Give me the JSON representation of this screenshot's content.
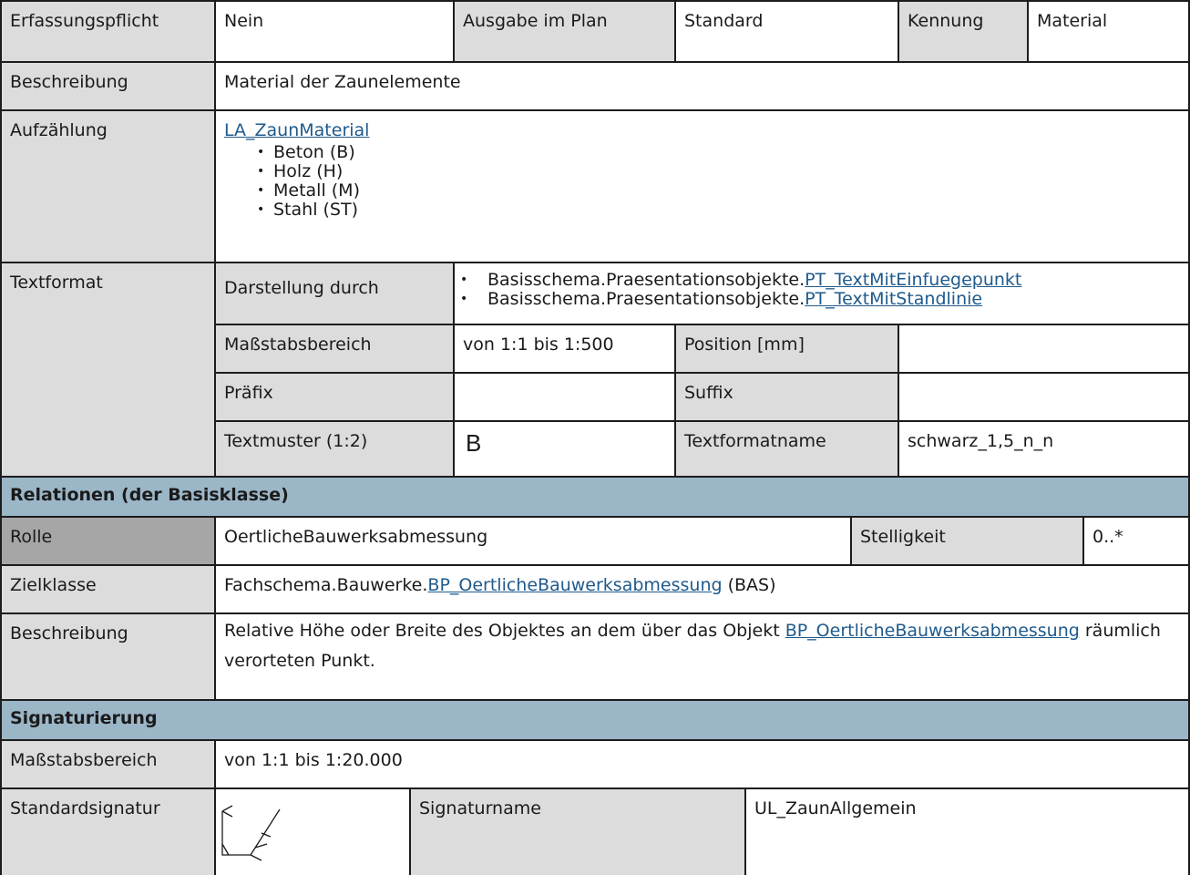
{
  "row_erfassung": {
    "label": "Erfassungspflicht",
    "value": "Nein",
    "ausgabe_label": "Ausgabe im Plan",
    "ausgabe_value": "Standard",
    "kennung_label": "Kennung",
    "kennung_value": "Material"
  },
  "beschreibung": {
    "label": "Beschreibung",
    "value": "Material der Zaunelemente"
  },
  "aufzaehlung": {
    "label": "Aufzählung",
    "link": "LA_ZaunMaterial",
    "items": [
      "Beton (B)",
      "Holz (H)",
      "Metall (M)",
      "Stahl (ST)"
    ]
  },
  "textformat": {
    "label": "Textformat",
    "darstellung_label": "Darstellung durch",
    "darstellung": [
      {
        "prefix": "Basisschema.Praesentationsobjekte.",
        "link": "PT_TextMitEinfuegepunkt"
      },
      {
        "prefix": "Basisschema.Praesentationsobjekte.",
        "link": "PT_TextMitStandlinie"
      }
    ],
    "massstab_label": "Maßstabsbereich",
    "massstab_value": "von 1:1 bis 1:500",
    "position_label": "Position [mm]",
    "position_value": "",
    "praefix_label": "Präfix",
    "praefix_value": "",
    "suffix_label": "Suffix",
    "suffix_value": "",
    "textmuster_label": "Textmuster (1:2)",
    "textmuster_value": "B",
    "textformatname_label": "Textformatname",
    "textformatname_value": "schwarz_1,5_n_n"
  },
  "relationen": {
    "header": "Relationen (der Basisklasse)",
    "rolle_label": "Rolle",
    "rolle_value": "OertlicheBauwerksabmessung",
    "stelligkeit_label": "Stelligkeit",
    "stelligkeit_value": "0..*",
    "zielklasse_label": "Zielklasse",
    "zielklasse_prefix": "Fachschema.Bauwerke.",
    "zielklasse_link": "BP_OertlicheBauwerksabmessung",
    "zielklasse_suffix": " (BAS)",
    "beschreibung_label": "Beschreibung",
    "beschreibung_pre": "Relative Höhe oder Breite des Objektes an dem über das Objekt ",
    "beschreibung_link": "BP_OertlicheBauwerksabmessung",
    "beschreibung_post": " räumlich verorteten Punkt."
  },
  "signaturierung": {
    "header": "Signaturierung",
    "massstab_label": "Maßstabsbereich",
    "massstab_value": "von 1:1 bis 1:20.000",
    "standard_label": "Standardsignatur",
    "signaturname_label": "Signaturname",
    "signaturname_value": "UL_ZaunAllgemein"
  },
  "colors": {
    "section_header": "#9bb6c7",
    "label_cell": "#dcdcdc",
    "role_cell": "#a6a6a6",
    "link": "#1f5a8c"
  }
}
